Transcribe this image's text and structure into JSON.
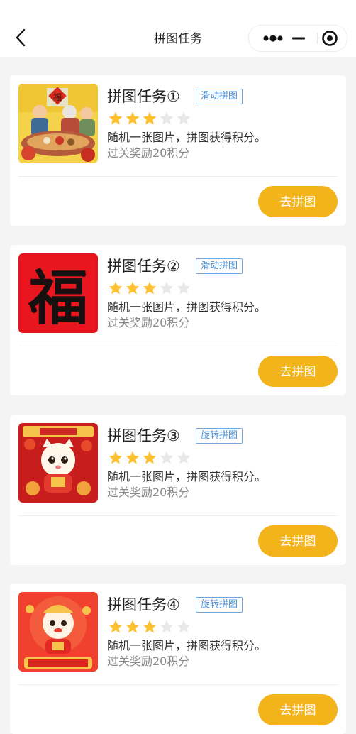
{
  "navbar": {
    "title": "拼图任务",
    "icons": [
      "back-icon",
      "more-icon",
      "minimize-icon",
      "close-target-icon"
    ]
  },
  "colors": {
    "accent": "#f3b31b",
    "tag_border": "#6fa6de",
    "tag_text": "#4c8fd6",
    "star_on": "#fcc031",
    "star_off": "#e8e8e8"
  },
  "tasks": [
    {
      "title": "拼图任务①",
      "tag": "滑动拼图",
      "rating": 3,
      "max_rating": 5,
      "description": "随机一张图片，拼图获得积分。",
      "reward": "过关奖励20积分",
      "button_label": "去拼图"
    },
    {
      "title": "拼图任务②",
      "tag": "滑动拼图",
      "rating": 3,
      "max_rating": 5,
      "description": "随机一张图片，拼图获得积分。",
      "reward": "过关奖励20积分",
      "button_label": "去拼图"
    },
    {
      "title": "拼图任务③",
      "tag": "旋转拼图",
      "rating": 3,
      "max_rating": 5,
      "description": "随机一张图片，拼图获得积分。",
      "reward": "过关奖励20积分",
      "button_label": "去拼图"
    },
    {
      "title": "拼图任务④",
      "tag": "旋转拼图",
      "rating": 3,
      "max_rating": 5,
      "description": "随机一张图片，拼图获得积分。",
      "reward": "过关奖励20积分",
      "button_label": "去拼图"
    }
  ]
}
